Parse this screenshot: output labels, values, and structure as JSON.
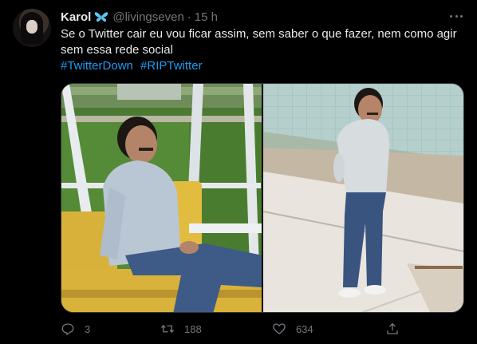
{
  "tweet": {
    "display_name": "Karol",
    "badge_icon": "butterfly-icon",
    "handle": "@livingseven",
    "separator": "·",
    "time": "15 h",
    "text_line1": "Se o Twitter cair eu vou ficar assim, sem saber o que fazer, nem como agir",
    "text_line2": "sem essa rede social",
    "hashtags": [
      "#TwitterDown",
      "#RIPTwitter"
    ],
    "reply_count": "3",
    "retweet_count": "188",
    "like_count": "634"
  },
  "colors": {
    "background": "#000000",
    "text": "#e7e9ea",
    "muted": "#71767b",
    "link": "#1d9bf0",
    "badge": "#5ec8f5"
  }
}
